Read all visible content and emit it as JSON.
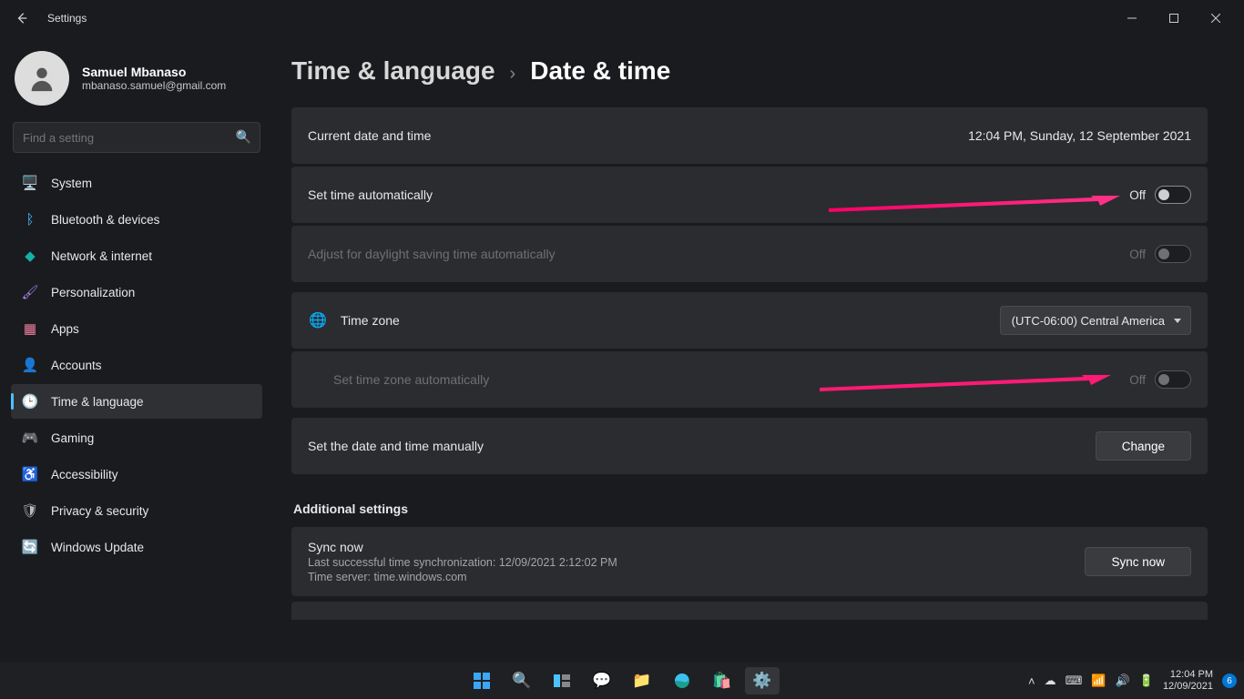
{
  "window": {
    "title": "Settings"
  },
  "user": {
    "name": "Samuel Mbanaso",
    "email": "mbanaso.samuel@gmail.com"
  },
  "search": {
    "placeholder": "Find a setting"
  },
  "nav": [
    {
      "icon": "🖥️",
      "label": "System",
      "cls": "ic-blue"
    },
    {
      "icon": "ᛒ",
      "label": "Bluetooth & devices",
      "cls": "ic-blue"
    },
    {
      "icon": "◆",
      "label": "Network & internet",
      "cls": "ic-teal"
    },
    {
      "icon": "🖌",
      "label": "Personalization",
      "cls": "ic-purple"
    },
    {
      "icon": "▦",
      "label": "Apps",
      "cls": "ic-pink"
    },
    {
      "icon": "👤",
      "label": "Accounts",
      "cls": "ic-green"
    },
    {
      "icon": "🕒",
      "label": "Time & language",
      "cls": "ic-gray"
    },
    {
      "icon": "🎮",
      "label": "Gaming",
      "cls": "ic-gray"
    },
    {
      "icon": "♿",
      "label": "Accessibility",
      "cls": "ic-blue"
    },
    {
      "icon": "🛡",
      "label": "Privacy & security",
      "cls": "ic-gray"
    },
    {
      "icon": "🔄",
      "label": "Windows Update",
      "cls": "ic-cyan"
    }
  ],
  "nav_active_index": 6,
  "breadcrumb": {
    "parent": "Time & language",
    "current": "Date & time"
  },
  "content": {
    "current_label": "Current date and time",
    "current_value": "12:04 PM, Sunday, 12 September 2021",
    "auto_time_label": "Set time automatically",
    "auto_time_state": "Off",
    "dst_label": "Adjust for daylight saving time automatically",
    "dst_state": "Off",
    "tz_label": "Time zone",
    "tz_value": "(UTC-06:00) Central America",
    "auto_tz_label": "Set time zone automatically",
    "auto_tz_state": "Off",
    "manual_label": "Set the date and time manually",
    "manual_button": "Change",
    "additional_heading": "Additional settings",
    "sync_title": "Sync now",
    "sync_line1": "Last successful time synchronization: 12/09/2021 2:12:02 PM",
    "sync_line2": "Time server: time.windows.com",
    "sync_button": "Sync now"
  },
  "taskbar": {
    "time": "12:04 PM",
    "date": "12/09/2021",
    "notif_count": "6"
  }
}
